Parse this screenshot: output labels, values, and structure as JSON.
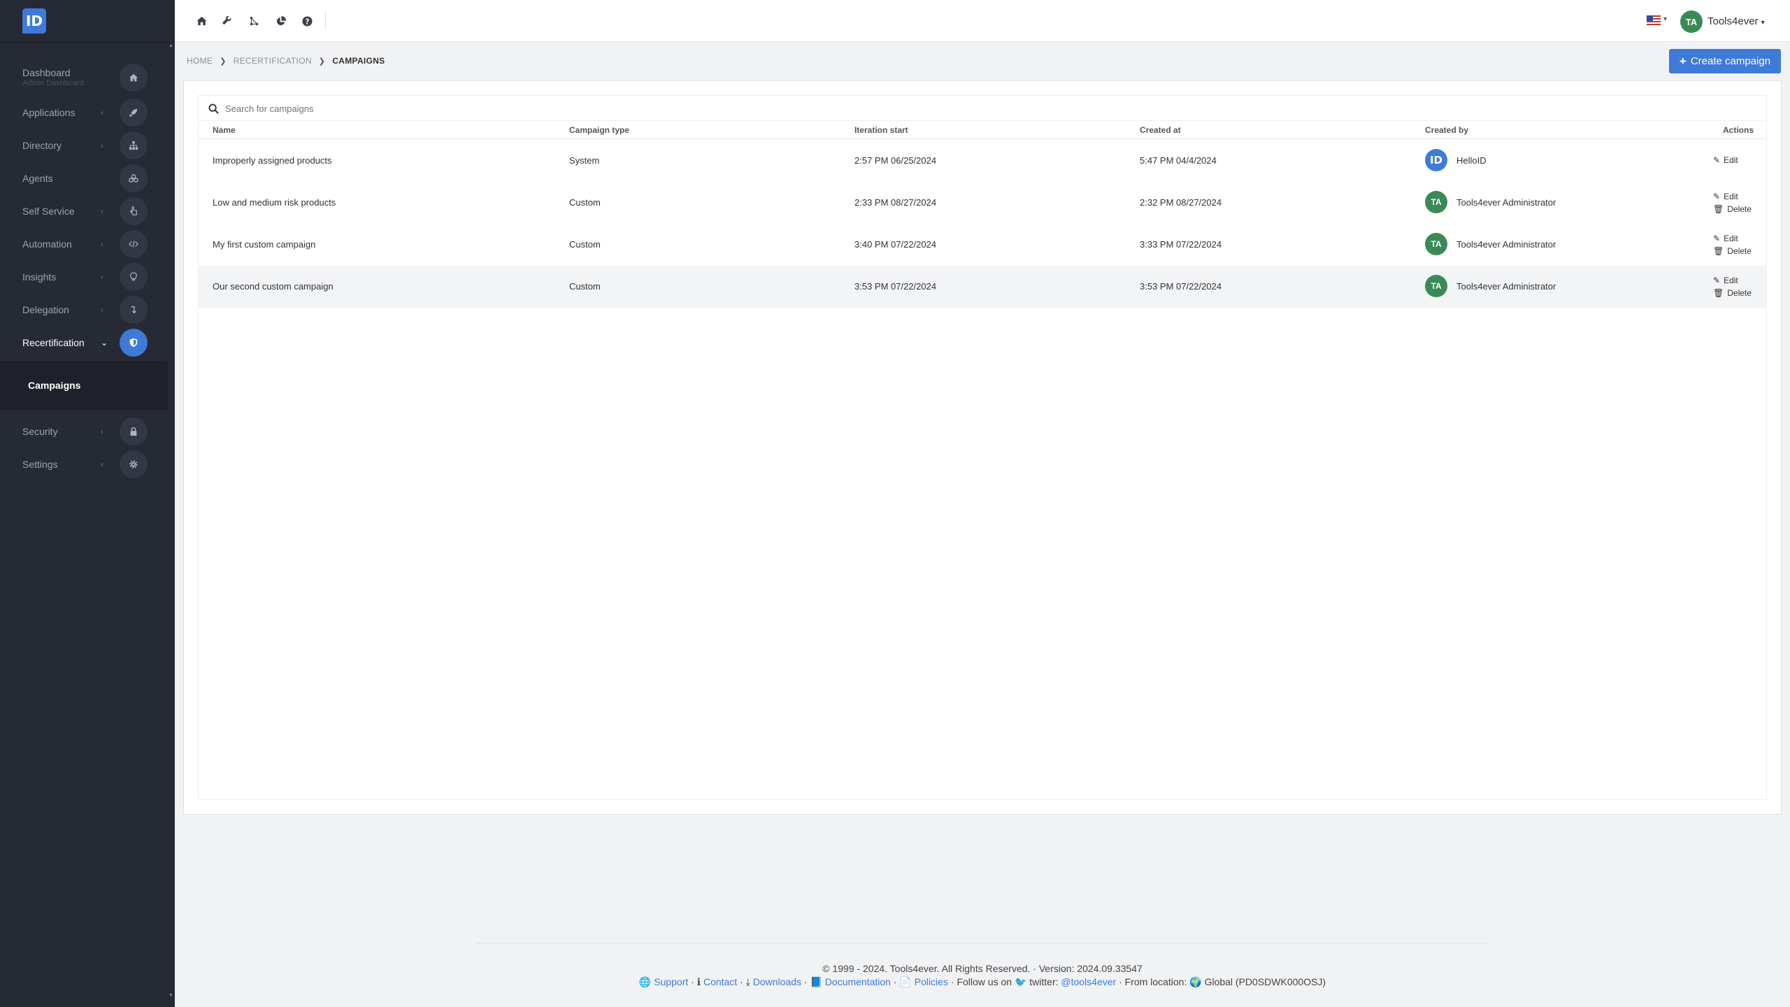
{
  "logo": "ID",
  "sidebar": {
    "items": [
      {
        "label": "Dashboard",
        "sub": "Admin Dashboard",
        "icon": "home-icon"
      },
      {
        "label": "Applications",
        "icon": "rocket-icon"
      },
      {
        "label": "Directory",
        "icon": "sitemap-icon"
      },
      {
        "label": "Agents",
        "icon": "agents-icon"
      },
      {
        "label": "Self Service",
        "icon": "hand-pointer-icon"
      },
      {
        "label": "Automation",
        "icon": "code-icon"
      },
      {
        "label": "Insights",
        "icon": "lightbulb-icon"
      },
      {
        "label": "Delegation",
        "icon": "level-down-icon"
      },
      {
        "label": "Recertification",
        "icon": "shield-icon"
      },
      {
        "label": "Security",
        "icon": "lock-icon"
      },
      {
        "label": "Settings",
        "icon": "gear-icon"
      }
    ],
    "subitems": [
      "Campaigns"
    ]
  },
  "topbar": {
    "user_initials": "TA",
    "user_name": "Tools4ever"
  },
  "breadcrumb": {
    "home": "HOME",
    "section": "RECERTIFICATION",
    "current": "CAMPAIGNS"
  },
  "create_button": "Create campaign",
  "search": {
    "placeholder": "Search for campaigns"
  },
  "table": {
    "headers": {
      "name": "Name",
      "type": "Campaign type",
      "iteration": "Iteration start",
      "created_at": "Created at",
      "created_by": "Created by",
      "actions": "Actions"
    },
    "edit_label": "Edit",
    "delete_label": "Delete",
    "rows": [
      {
        "name": "Improperly assigned products",
        "type": "System",
        "iteration": "2:57 PM 06/25/2024",
        "created_at": "5:47 PM 04/4/2024",
        "avatar": "ID",
        "created_by": "HelloID"
      },
      {
        "name": "Low and medium risk products",
        "type": "Custom",
        "iteration": "2:33 PM 08/27/2024",
        "created_at": "2:32 PM 08/27/2024",
        "avatar": "TA",
        "created_by": "Tools4ever Administrator"
      },
      {
        "name": "My first custom campaign",
        "type": "Custom",
        "iteration": "3:40 PM 07/22/2024",
        "created_at": "3:33 PM 07/22/2024",
        "avatar": "TA",
        "created_by": "Tools4ever Administrator"
      },
      {
        "name": "Our second custom campaign",
        "type": "Custom",
        "iteration": "3:53 PM 07/22/2024",
        "created_at": "3:53 PM 07/22/2024",
        "avatar": "TA",
        "created_by": "Tools4ever Administrator"
      }
    ]
  },
  "footer": {
    "copyright": "© 1999 - 2024. Tools4ever. All Rights Reserved. · Version: 2024.09.33547",
    "support": "Support",
    "contact": "Contact",
    "downloads": "Downloads",
    "documentation": "Documentation",
    "policies": "Policies",
    "follow": "Follow us on",
    "twitter": "twitter:",
    "twitter_handle": "@tools4ever",
    "from_location": "From location:",
    "location": "Global (PD0SDWK000OSJ)"
  },
  "colors": {
    "accent": "#3f7ad8",
    "sidebar_bg": "#262a35",
    "avatar_green": "#3a8a56"
  }
}
